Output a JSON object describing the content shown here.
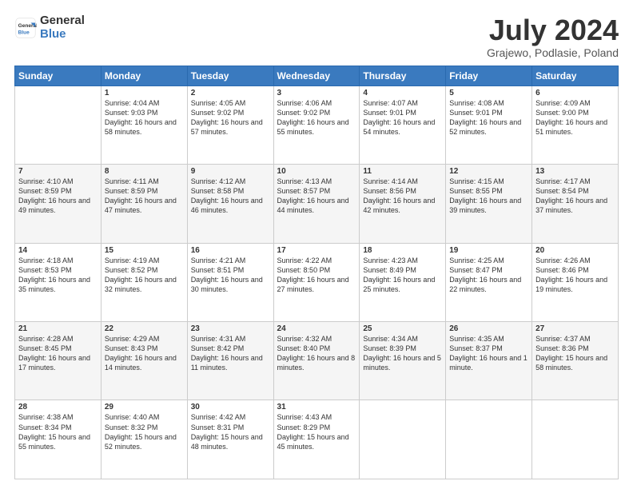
{
  "logo": {
    "general": "General",
    "blue": "Blue"
  },
  "title": "July 2024",
  "subtitle": "Grajewo, Podlasie, Poland",
  "header_days": [
    "Sunday",
    "Monday",
    "Tuesday",
    "Wednesday",
    "Thursday",
    "Friday",
    "Saturday"
  ],
  "weeks": [
    [
      {
        "day": "",
        "sunrise": "",
        "sunset": "",
        "daylight": ""
      },
      {
        "day": "1",
        "sunrise": "Sunrise: 4:04 AM",
        "sunset": "Sunset: 9:03 PM",
        "daylight": "Daylight: 16 hours and 58 minutes."
      },
      {
        "day": "2",
        "sunrise": "Sunrise: 4:05 AM",
        "sunset": "Sunset: 9:02 PM",
        "daylight": "Daylight: 16 hours and 57 minutes."
      },
      {
        "day": "3",
        "sunrise": "Sunrise: 4:06 AM",
        "sunset": "Sunset: 9:02 PM",
        "daylight": "Daylight: 16 hours and 55 minutes."
      },
      {
        "day": "4",
        "sunrise": "Sunrise: 4:07 AM",
        "sunset": "Sunset: 9:01 PM",
        "daylight": "Daylight: 16 hours and 54 minutes."
      },
      {
        "day": "5",
        "sunrise": "Sunrise: 4:08 AM",
        "sunset": "Sunset: 9:01 PM",
        "daylight": "Daylight: 16 hours and 52 minutes."
      },
      {
        "day": "6",
        "sunrise": "Sunrise: 4:09 AM",
        "sunset": "Sunset: 9:00 PM",
        "daylight": "Daylight: 16 hours and 51 minutes."
      }
    ],
    [
      {
        "day": "7",
        "sunrise": "Sunrise: 4:10 AM",
        "sunset": "Sunset: 8:59 PM",
        "daylight": "Daylight: 16 hours and 49 minutes."
      },
      {
        "day": "8",
        "sunrise": "Sunrise: 4:11 AM",
        "sunset": "Sunset: 8:59 PM",
        "daylight": "Daylight: 16 hours and 47 minutes."
      },
      {
        "day": "9",
        "sunrise": "Sunrise: 4:12 AM",
        "sunset": "Sunset: 8:58 PM",
        "daylight": "Daylight: 16 hours and 46 minutes."
      },
      {
        "day": "10",
        "sunrise": "Sunrise: 4:13 AM",
        "sunset": "Sunset: 8:57 PM",
        "daylight": "Daylight: 16 hours and 44 minutes."
      },
      {
        "day": "11",
        "sunrise": "Sunrise: 4:14 AM",
        "sunset": "Sunset: 8:56 PM",
        "daylight": "Daylight: 16 hours and 42 minutes."
      },
      {
        "day": "12",
        "sunrise": "Sunrise: 4:15 AM",
        "sunset": "Sunset: 8:55 PM",
        "daylight": "Daylight: 16 hours and 39 minutes."
      },
      {
        "day": "13",
        "sunrise": "Sunrise: 4:17 AM",
        "sunset": "Sunset: 8:54 PM",
        "daylight": "Daylight: 16 hours and 37 minutes."
      }
    ],
    [
      {
        "day": "14",
        "sunrise": "Sunrise: 4:18 AM",
        "sunset": "Sunset: 8:53 PM",
        "daylight": "Daylight: 16 hours and 35 minutes."
      },
      {
        "day": "15",
        "sunrise": "Sunrise: 4:19 AM",
        "sunset": "Sunset: 8:52 PM",
        "daylight": "Daylight: 16 hours and 32 minutes."
      },
      {
        "day": "16",
        "sunrise": "Sunrise: 4:21 AM",
        "sunset": "Sunset: 8:51 PM",
        "daylight": "Daylight: 16 hours and 30 minutes."
      },
      {
        "day": "17",
        "sunrise": "Sunrise: 4:22 AM",
        "sunset": "Sunset: 8:50 PM",
        "daylight": "Daylight: 16 hours and 27 minutes."
      },
      {
        "day": "18",
        "sunrise": "Sunrise: 4:23 AM",
        "sunset": "Sunset: 8:49 PM",
        "daylight": "Daylight: 16 hours and 25 minutes."
      },
      {
        "day": "19",
        "sunrise": "Sunrise: 4:25 AM",
        "sunset": "Sunset: 8:47 PM",
        "daylight": "Daylight: 16 hours and 22 minutes."
      },
      {
        "day": "20",
        "sunrise": "Sunrise: 4:26 AM",
        "sunset": "Sunset: 8:46 PM",
        "daylight": "Daylight: 16 hours and 19 minutes."
      }
    ],
    [
      {
        "day": "21",
        "sunrise": "Sunrise: 4:28 AM",
        "sunset": "Sunset: 8:45 PM",
        "daylight": "Daylight: 16 hours and 17 minutes."
      },
      {
        "day": "22",
        "sunrise": "Sunrise: 4:29 AM",
        "sunset": "Sunset: 8:43 PM",
        "daylight": "Daylight: 16 hours and 14 minutes."
      },
      {
        "day": "23",
        "sunrise": "Sunrise: 4:31 AM",
        "sunset": "Sunset: 8:42 PM",
        "daylight": "Daylight: 16 hours and 11 minutes."
      },
      {
        "day": "24",
        "sunrise": "Sunrise: 4:32 AM",
        "sunset": "Sunset: 8:40 PM",
        "daylight": "Daylight: 16 hours and 8 minutes."
      },
      {
        "day": "25",
        "sunrise": "Sunrise: 4:34 AM",
        "sunset": "Sunset: 8:39 PM",
        "daylight": "Daylight: 16 hours and 5 minutes."
      },
      {
        "day": "26",
        "sunrise": "Sunrise: 4:35 AM",
        "sunset": "Sunset: 8:37 PM",
        "daylight": "Daylight: 16 hours and 1 minute."
      },
      {
        "day": "27",
        "sunrise": "Sunrise: 4:37 AM",
        "sunset": "Sunset: 8:36 PM",
        "daylight": "Daylight: 15 hours and 58 minutes."
      }
    ],
    [
      {
        "day": "28",
        "sunrise": "Sunrise: 4:38 AM",
        "sunset": "Sunset: 8:34 PM",
        "daylight": "Daylight: 15 hours and 55 minutes."
      },
      {
        "day": "29",
        "sunrise": "Sunrise: 4:40 AM",
        "sunset": "Sunset: 8:32 PM",
        "daylight": "Daylight: 15 hours and 52 minutes."
      },
      {
        "day": "30",
        "sunrise": "Sunrise: 4:42 AM",
        "sunset": "Sunset: 8:31 PM",
        "daylight": "Daylight: 15 hours and 48 minutes."
      },
      {
        "day": "31",
        "sunrise": "Sunrise: 4:43 AM",
        "sunset": "Sunset: 8:29 PM",
        "daylight": "Daylight: 15 hours and 45 minutes."
      },
      {
        "day": "",
        "sunrise": "",
        "sunset": "",
        "daylight": ""
      },
      {
        "day": "",
        "sunrise": "",
        "sunset": "",
        "daylight": ""
      },
      {
        "day": "",
        "sunrise": "",
        "sunset": "",
        "daylight": ""
      }
    ]
  ]
}
